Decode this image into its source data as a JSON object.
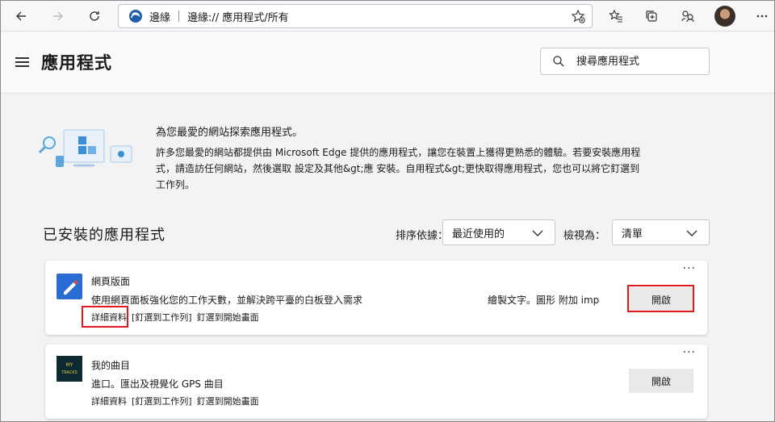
{
  "toolbar": {
    "site_name": "邊緣",
    "url": "邊緣:// 應用程式/所有",
    "icons": [
      "back-arrow-icon",
      "forward-arrow-icon",
      "refresh-icon",
      "edge-logo-icon",
      "add-favorite-icon",
      "favorites-icon",
      "collections-icon",
      "profile-switch-icon",
      "more-icon"
    ]
  },
  "header": {
    "title": "應用程式",
    "search_placeholder": "搜尋應用程式"
  },
  "intro": {
    "title": "為您最愛的網站探索應用程式。",
    "body": "許多您最愛的網站都提供由 Microsoft Edge 提供的應用程式，讓您在裝置上獲得更熟悉的體驗。若要安裝應用程式，請造訪任何網站，然後選取 設定及其他&gt;應            安裝。自用程式&gt;更快取得應用程式，您也可以將它釘選到工作列。"
  },
  "installed": {
    "title": "已安裝的應用程式",
    "sort_label": "排序依據：",
    "sort_value": "最近使用的",
    "view_label": "檢視為：",
    "view_value": "清單"
  },
  "apps": [
    {
      "name": "網頁版面",
      "description": "使用網頁面板強化您的工作天數，並解決跨平臺的白板登入需求",
      "extra": "繪製文字。圖形 附加 imp",
      "links": [
        "詳細資料",
        "[釘選到工作列]",
        "釘選到開始畫面"
      ],
      "open_label": "開啟",
      "icon_color": "#2b6cd4"
    },
    {
      "name": "我的曲目",
      "description": "進口。匯出及視覺化 GPS 曲目",
      "icon_text": "MY TRACKS",
      "links": [
        "詳細資料",
        "[釘選到工作列]",
        "釘選到開始畫面"
      ],
      "open_label": "開啟",
      "icon_color": "#0d2a33"
    }
  ],
  "more_glyph": "···",
  "colors": {
    "highlight": "#e0191e",
    "button": "#e9e9e9"
  }
}
